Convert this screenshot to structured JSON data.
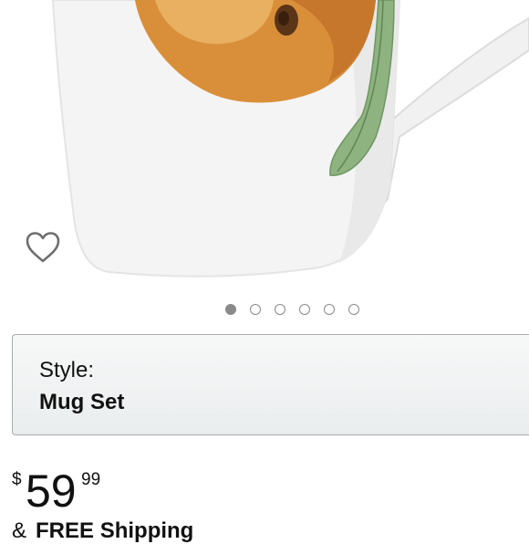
{
  "product": {
    "image_alt": "Mug set product photo",
    "gallery": {
      "count": 6,
      "active_index": 0
    },
    "wishlist_icon": "heart-outline-icon"
  },
  "style": {
    "label": "Style:",
    "value": "Mug Set"
  },
  "price": {
    "symbol": "$",
    "whole": "59",
    "fraction": "99"
  },
  "shipping": {
    "prefix": "&",
    "text": "FREE Shipping"
  },
  "colors": {
    "dot": "#8a8a8a",
    "box_border": "#a9abad"
  }
}
